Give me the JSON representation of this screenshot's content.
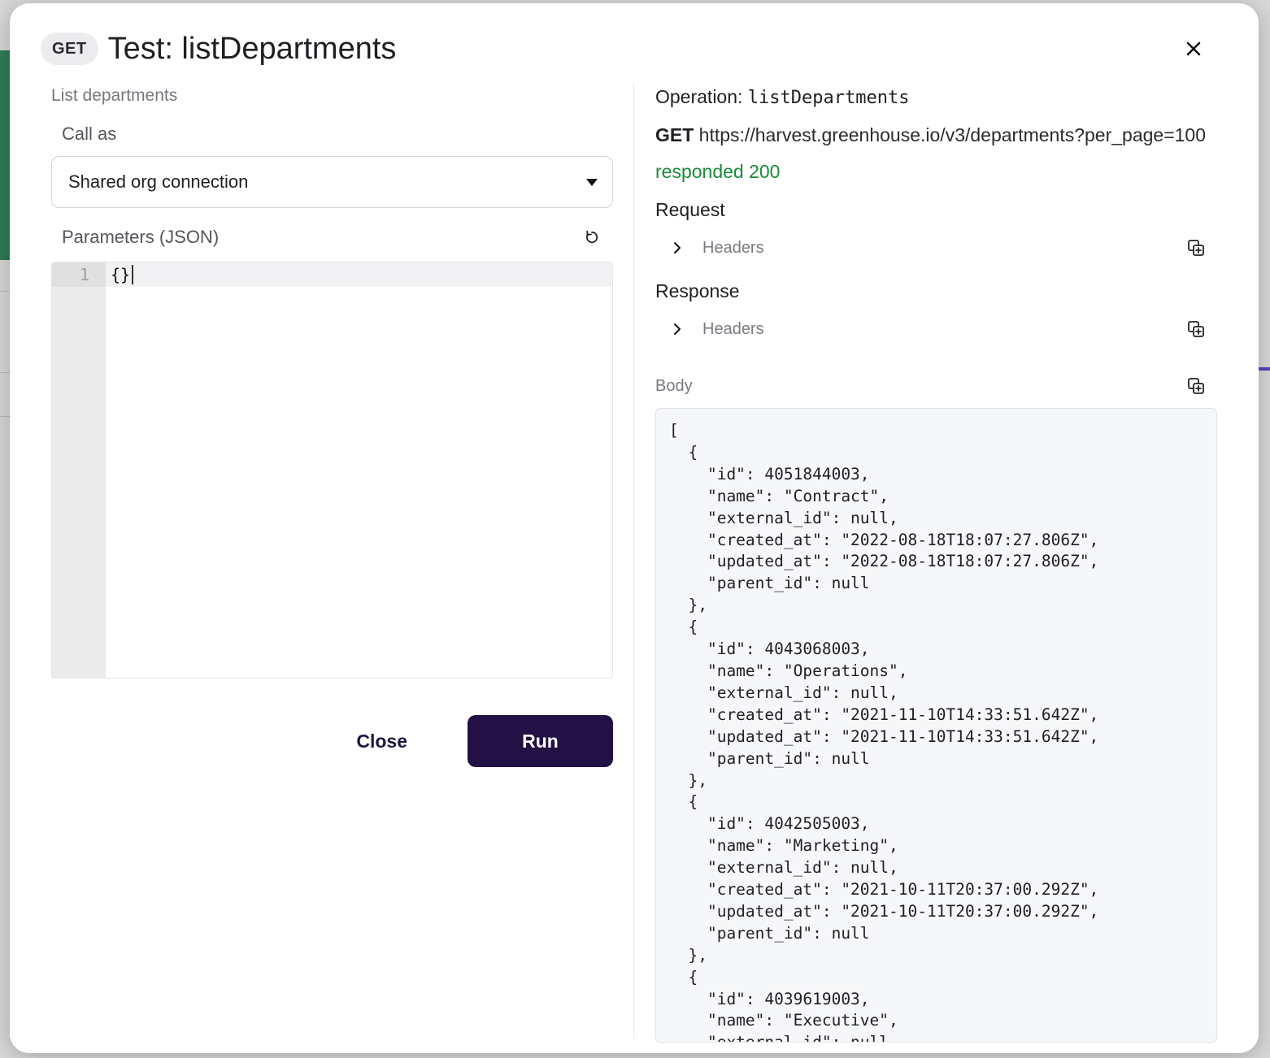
{
  "modal": {
    "method": "GET",
    "title": "Test: listDepartments"
  },
  "left": {
    "summary": "List departments",
    "call_as_label": "Call as",
    "call_as_value": "Shared org connection",
    "params_label": "Parameters (JSON)",
    "editor": {
      "line_numbers": [
        "1"
      ],
      "lines": [
        "{}"
      ]
    },
    "close_label": "Close",
    "run_label": "Run"
  },
  "right": {
    "operation_prefix": "Operation:",
    "operation_name": "listDepartments",
    "method": "GET",
    "url": "https://harvest.greenhouse.io/v3/departments?per_page=100",
    "status": "responded 200",
    "request_label": "Request",
    "request_headers_label": "Headers",
    "response_label": "Response",
    "response_headers_label": "Headers",
    "body_label": "Body",
    "body_text": "[\n  {\n    \"id\": 4051844003,\n    \"name\": \"Contract\",\n    \"external_id\": null,\n    \"created_at\": \"2022-08-18T18:07:27.806Z\",\n    \"updated_at\": \"2022-08-18T18:07:27.806Z\",\n    \"parent_id\": null\n  },\n  {\n    \"id\": 4043068003,\n    \"name\": \"Operations\",\n    \"external_id\": null,\n    \"created_at\": \"2021-11-10T14:33:51.642Z\",\n    \"updated_at\": \"2021-11-10T14:33:51.642Z\",\n    \"parent_id\": null\n  },\n  {\n    \"id\": 4042505003,\n    \"name\": \"Marketing\",\n    \"external_id\": null,\n    \"created_at\": \"2021-10-11T20:37:00.292Z\",\n    \"updated_at\": \"2021-10-11T20:37:00.292Z\",\n    \"parent_id\": null\n  },\n  {\n    \"id\": 4039619003,\n    \"name\": \"Executive\",\n    \"external_id\": null,"
  },
  "colors": {
    "accent": "#221144",
    "status_ok": "#1a8a3a"
  },
  "icons": {
    "close": "close-icon",
    "reset": "reset-icon",
    "chevron": "chevron-right-icon",
    "copy": "copy-icon",
    "dropdown": "caret-down-icon"
  }
}
